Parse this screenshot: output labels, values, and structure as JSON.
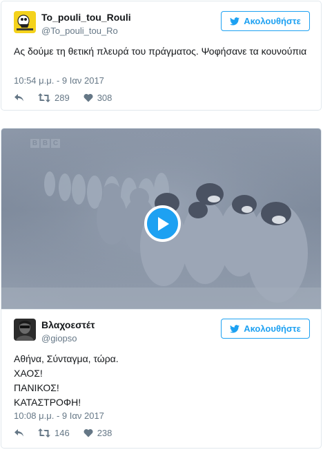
{
  "tweet1": {
    "display_name": "To_pouli_tou_Rouli",
    "handle": "@To_pouli_tou_Ro",
    "follow_label": "Ακολουθήστε",
    "text": "Ας δούμε τη θετική πλευρά του πράγματος. Ψοφήσανε τα κουνούπια",
    "timestamp": "10:54 μ.μ. - 9 Ιαν 2017",
    "retweets": "289",
    "likes": "308"
  },
  "tweet2": {
    "video_watermark": [
      "B",
      "B",
      "C"
    ],
    "display_name": "Βλαχοεστέτ",
    "handle": "@giopso",
    "follow_label": "Ακολουθήστε",
    "lines": [
      "Αθήνα, Σύνταγμα, τώρα.",
      "ΧΑΟΣ!",
      "ΠΑΝΙΚΟΣ!",
      "ΚΑΤΑΣΤΡΟΦΗ!"
    ],
    "timestamp": "10:08 μ.μ. - 9 Ιαν 2017",
    "retweets": "146",
    "likes": "238"
  },
  "colors": {
    "brand_blue": "#1da1f2",
    "muted_text": "#657786",
    "border": "#e1e8ed"
  },
  "icons": [
    "twitter-bird-icon",
    "reply-icon",
    "retweet-icon",
    "heart-icon",
    "play-icon"
  ]
}
